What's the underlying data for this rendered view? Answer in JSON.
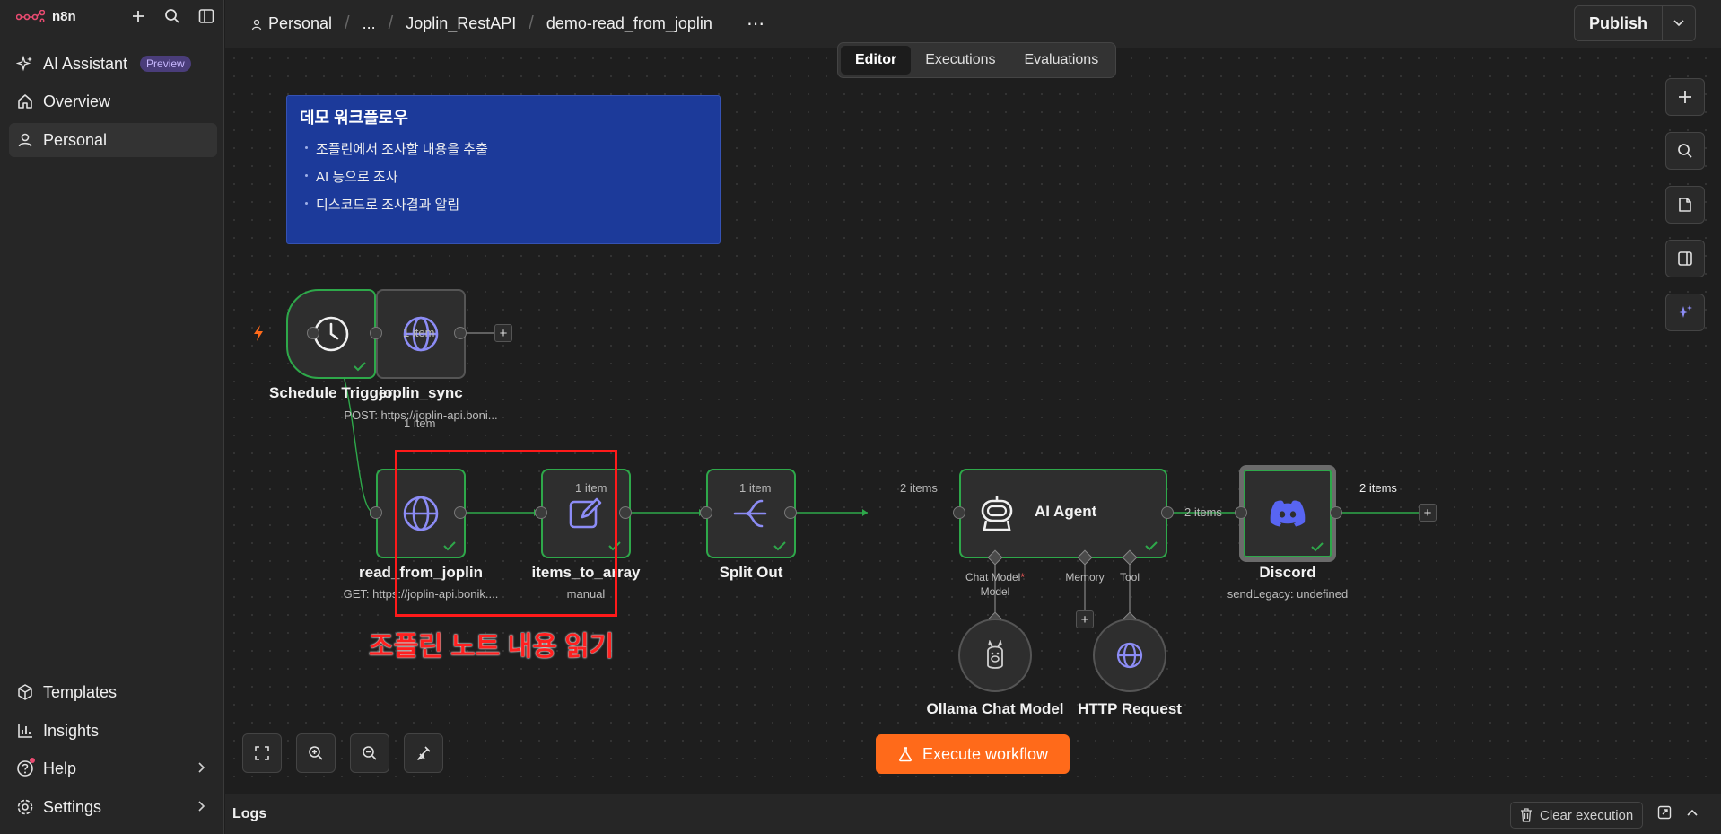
{
  "app": {
    "name": "n8n"
  },
  "sidebar": {
    "items": [
      {
        "label": "AI Assistant",
        "badge": "Preview",
        "icon": "sparkles-icon"
      },
      {
        "label": "Overview",
        "icon": "home-icon"
      },
      {
        "label": "Personal",
        "icon": "user-icon"
      }
    ],
    "bottom": [
      {
        "label": "Templates",
        "icon": "box-icon"
      },
      {
        "label": "Insights",
        "icon": "chart-icon"
      },
      {
        "label": "Help",
        "icon": "help-icon"
      },
      {
        "label": "Settings",
        "icon": "gear-icon"
      }
    ]
  },
  "header": {
    "breadcrumbs": [
      "Personal",
      "...",
      "Joplin_RestAPI",
      "demo-read_from_joplin"
    ],
    "more": "⋯",
    "publish": "Publish",
    "tabs": [
      "Editor",
      "Executions",
      "Evaluations"
    ]
  },
  "sticky": {
    "title": "데모 워크플로우",
    "items": [
      "조플린에서 조사할 내용을 추출",
      "AI 등으로 조사",
      "디스코드로 조사결과 알림"
    ]
  },
  "nodes": {
    "schedule": {
      "label": "Schedule Trigger"
    },
    "joplin_sync": {
      "label": "joplin_sync",
      "sub": "POST: https://joplin-api.boni..."
    },
    "read_from_joplin": {
      "label": "read_from_joplin",
      "sub": "GET: https://joplin-api.bonik...."
    },
    "items_to_array": {
      "label": "items_to_array",
      "sub": "manual"
    },
    "split_out": {
      "label": "Split Out"
    },
    "ai_agent": {
      "label": "AI Agent",
      "ports": {
        "chat_model": "Chat Model",
        "model": "Model",
        "memory": "Memory",
        "tool": "Tool",
        "required": "*"
      }
    },
    "discord": {
      "label": "Discord",
      "sub": "sendLegacy: undefined"
    },
    "ollama": {
      "label": "Ollama Chat Model"
    },
    "http": {
      "label": "HTTP Request"
    }
  },
  "edges": {
    "e1": "1 item",
    "e2": "1 item",
    "e3": "1 item",
    "e4": "1 item",
    "e5": "2 items",
    "e6": "2 items",
    "e7": "2 items"
  },
  "annotation": "조플린 노트 내용 읽기",
  "execute": "Execute workflow",
  "logs": {
    "title": "Logs",
    "clear": "Clear execution"
  },
  "colors": {
    "accent": "#ff6a1a",
    "success": "#2ea84a",
    "node_icon": "#8c8cf5",
    "sticky": "#1c3a9a",
    "highlight": "#ff1a1a"
  }
}
